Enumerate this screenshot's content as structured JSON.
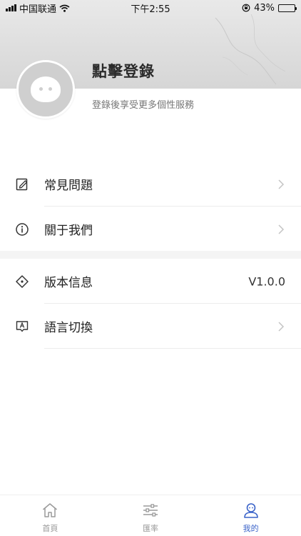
{
  "status_bar": {
    "carrier": "中国联通",
    "time": "下午2:55",
    "battery": "43%",
    "battery_level": 0.43
  },
  "profile": {
    "title": "點擊登錄",
    "subtitle": "登錄後享受更多個性服務"
  },
  "menu_groups": [
    {
      "items": [
        {
          "label": "常見問題",
          "icon": "edit-icon"
        },
        {
          "label": "關于我們",
          "icon": "info-icon"
        }
      ]
    },
    {
      "items": [
        {
          "label": "版本信息",
          "icon": "version-icon",
          "value": "V1.0.0"
        },
        {
          "label": "語言切換",
          "icon": "language-icon"
        }
      ]
    }
  ],
  "tabbar": {
    "items": [
      {
        "label": "首頁",
        "icon": "home-icon"
      },
      {
        "label": "匯率",
        "icon": "sliders-icon"
      },
      {
        "label": "我的",
        "icon": "profile-icon"
      }
    ],
    "active_index": 2,
    "active_color": "#3a63c9",
    "inactive_color": "#999999"
  }
}
